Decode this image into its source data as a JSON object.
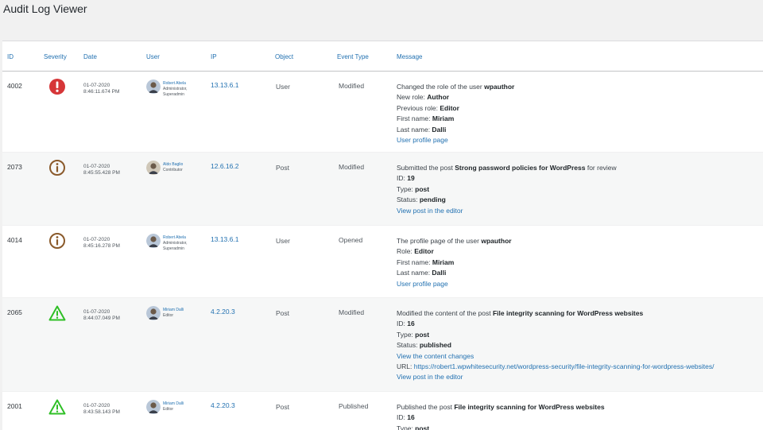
{
  "page": {
    "title": "Audit Log Viewer"
  },
  "columns": [
    "ID",
    "Severity",
    "Date",
    "User",
    "IP",
    "Object",
    "Event Type",
    "Message"
  ],
  "colors": {
    "critical": "#d63638",
    "medium": "#8a5a2b",
    "low": "#2fbf26",
    "link": "#2271b1"
  },
  "rows": [
    {
      "id": "4002",
      "severity": "critical",
      "severity_icon": "exclamation-circle-icon",
      "date": "01-07-2020",
      "time": "8:46:11.674 PM",
      "user": "Robert Abela",
      "roles": [
        "Administrator,",
        "Superadmin"
      ],
      "ip": "13.13.6.1",
      "object": "User",
      "event_type": "Modified",
      "message": [
        [
          {
            "t": "Changed the role of the user "
          },
          {
            "t": "wpauthor",
            "b": true
          }
        ],
        [
          {
            "t": "New role: "
          },
          {
            "t": "Author",
            "b": true
          }
        ],
        [
          {
            "t": "Previous role: "
          },
          {
            "t": "Editor",
            "b": true
          }
        ],
        [
          {
            "t": "First name: "
          },
          {
            "t": "Miriam",
            "b": true
          }
        ],
        [
          {
            "t": "Last name: "
          },
          {
            "t": "Dalli",
            "b": true
          }
        ],
        [
          {
            "t": "User profile page",
            "link": true
          }
        ]
      ]
    },
    {
      "id": "2073",
      "severity": "medium",
      "severity_icon": "info-circle-icon",
      "date": "01-07-2020",
      "time": "8:45:55.428 PM",
      "user": "Aldo Baglio",
      "roles": [
        "Contributor"
      ],
      "ip": "12.6.16.2",
      "object": "Post",
      "event_type": "Modified",
      "message": [
        [
          {
            "t": "Submitted the post "
          },
          {
            "t": "Strong password policies for WordPress",
            "b": true
          },
          {
            "t": " for review"
          }
        ],
        [
          {
            "t": "ID: "
          },
          {
            "t": "19",
            "b": true
          }
        ],
        [
          {
            "t": "Type: "
          },
          {
            "t": "post",
            "b": true
          }
        ],
        [
          {
            "t": "Status: "
          },
          {
            "t": "pending",
            "b": true
          }
        ],
        [
          {
            "t": "View post in the editor",
            "link": true
          }
        ]
      ]
    },
    {
      "id": "4014",
      "severity": "medium",
      "severity_icon": "info-circle-icon",
      "date": "01-07-2020",
      "time": "8:45:16.278 PM",
      "user": "Robert Abela",
      "roles": [
        "Administrator,",
        "Superadmin"
      ],
      "ip": "13.13.6.1",
      "object": "User",
      "event_type": "Opened",
      "message": [
        [
          {
            "t": "The profile page of the user "
          },
          {
            "t": "wpauthor",
            "b": true
          }
        ],
        [
          {
            "t": "Role: "
          },
          {
            "t": "Editor",
            "b": true
          }
        ],
        [
          {
            "t": "First name: "
          },
          {
            "t": "Miriam",
            "b": true
          }
        ],
        [
          {
            "t": "Last name: "
          },
          {
            "t": "Dalli",
            "b": true
          }
        ],
        [
          {
            "t": "User profile page",
            "link": true
          }
        ]
      ]
    },
    {
      "id": "2065",
      "severity": "low",
      "severity_icon": "warning-triangle-icon",
      "date": "01-07-2020",
      "time": "8:44:07.049 PM",
      "user": "Miriam Dalli",
      "roles": [
        "Editor"
      ],
      "ip": "4.2.20.3",
      "object": "Post",
      "event_type": "Modified",
      "message": [
        [
          {
            "t": "Modified the content of the post "
          },
          {
            "t": "File integrity scanning for WordPress websites",
            "b": true
          }
        ],
        [
          {
            "t": "ID: "
          },
          {
            "t": "16",
            "b": true
          }
        ],
        [
          {
            "t": "Type: "
          },
          {
            "t": "post",
            "b": true
          }
        ],
        [
          {
            "t": "Status: "
          },
          {
            "t": "published",
            "b": true
          }
        ],
        [
          {
            "t": "View the content changes",
            "link": true
          }
        ],
        [
          {
            "t": "URL: "
          },
          {
            "t": "https://robert1.wpwhitesecurity.net/wordpress-security/file-integrity-scanning-for-wordpress-websites/",
            "link": true
          }
        ],
        [
          {
            "t": "View post in the editor",
            "link": true
          }
        ]
      ]
    },
    {
      "id": "2001",
      "severity": "low",
      "severity_icon": "warning-triangle-icon",
      "date": "01-07-2020",
      "time": "8:43:58.143 PM",
      "user": "Miriam Dalli",
      "roles": [
        "Editor"
      ],
      "ip": "4.2.20.3",
      "object": "Post",
      "event_type": "Published",
      "message": [
        [
          {
            "t": "Published the post "
          },
          {
            "t": "File integrity scanning for WordPress websites",
            "b": true
          }
        ],
        [
          {
            "t": "ID: "
          },
          {
            "t": "16",
            "b": true
          }
        ],
        [
          {
            "t": "Type: "
          },
          {
            "t": "post",
            "b": true
          }
        ]
      ]
    }
  ]
}
